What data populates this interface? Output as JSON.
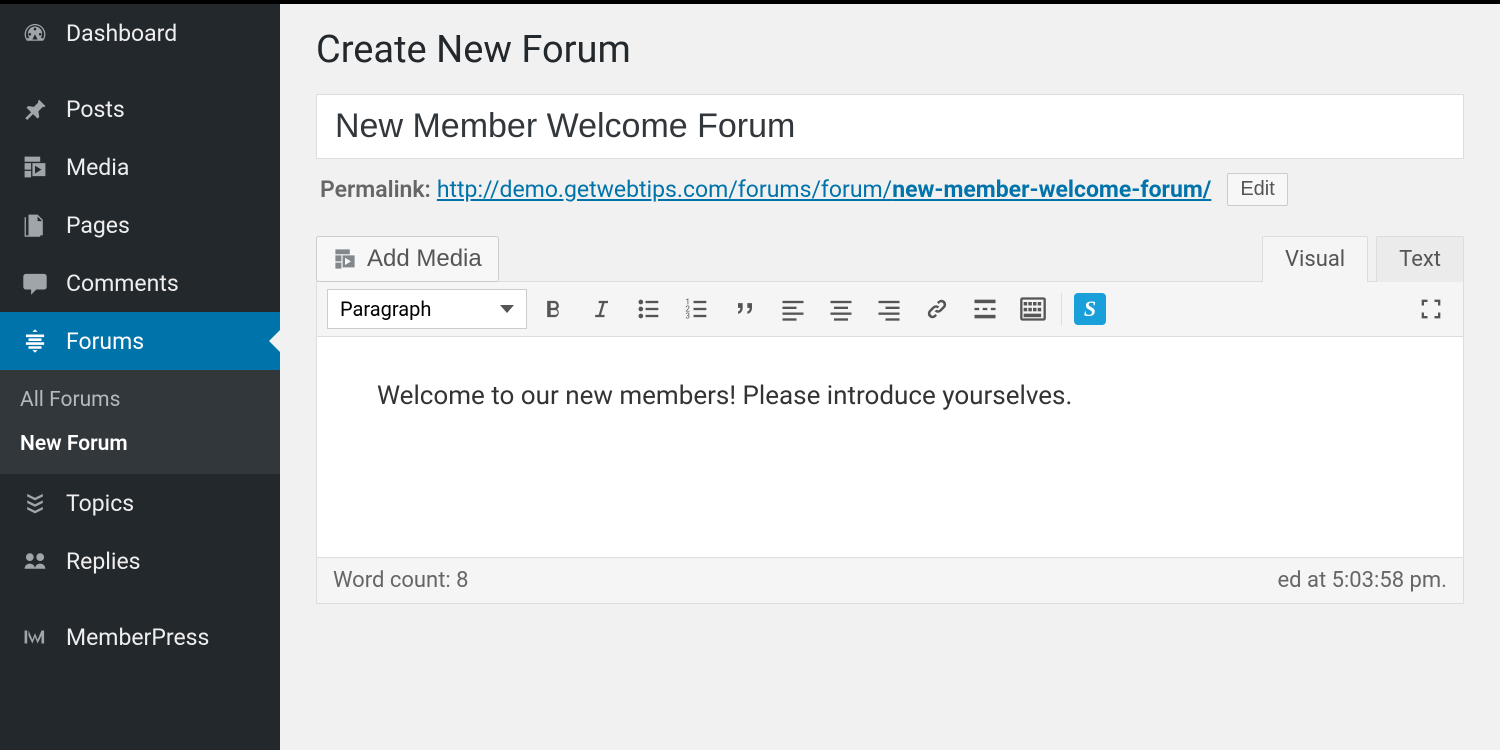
{
  "sidebar": {
    "items": [
      {
        "label": "Dashboard"
      },
      {
        "label": "Posts"
      },
      {
        "label": "Media"
      },
      {
        "label": "Pages"
      },
      {
        "label": "Comments"
      },
      {
        "label": "Forums"
      },
      {
        "label": "Topics"
      },
      {
        "label": "Replies"
      },
      {
        "label": "MemberPress"
      }
    ],
    "submenu": [
      {
        "label": "All Forums"
      },
      {
        "label": "New Forum"
      }
    ]
  },
  "page": {
    "title": "Create New Forum",
    "title_input": "New Member Welcome Forum",
    "permalink_label": "Permalink:",
    "permalink_base": "http://demo.getwebtips.com/forums/forum/",
    "permalink_slug": "new-member-welcome-forum/",
    "edit_label": "Edit"
  },
  "editor": {
    "add_media_label": "Add Media",
    "tabs": {
      "visual": "Visual",
      "text": "Text"
    },
    "format_select": "Paragraph",
    "content": "Welcome to our new members! Please introduce yourselves.",
    "word_count_label": "Word count: 8",
    "saved_label": "ed at 5:03:58 pm."
  }
}
